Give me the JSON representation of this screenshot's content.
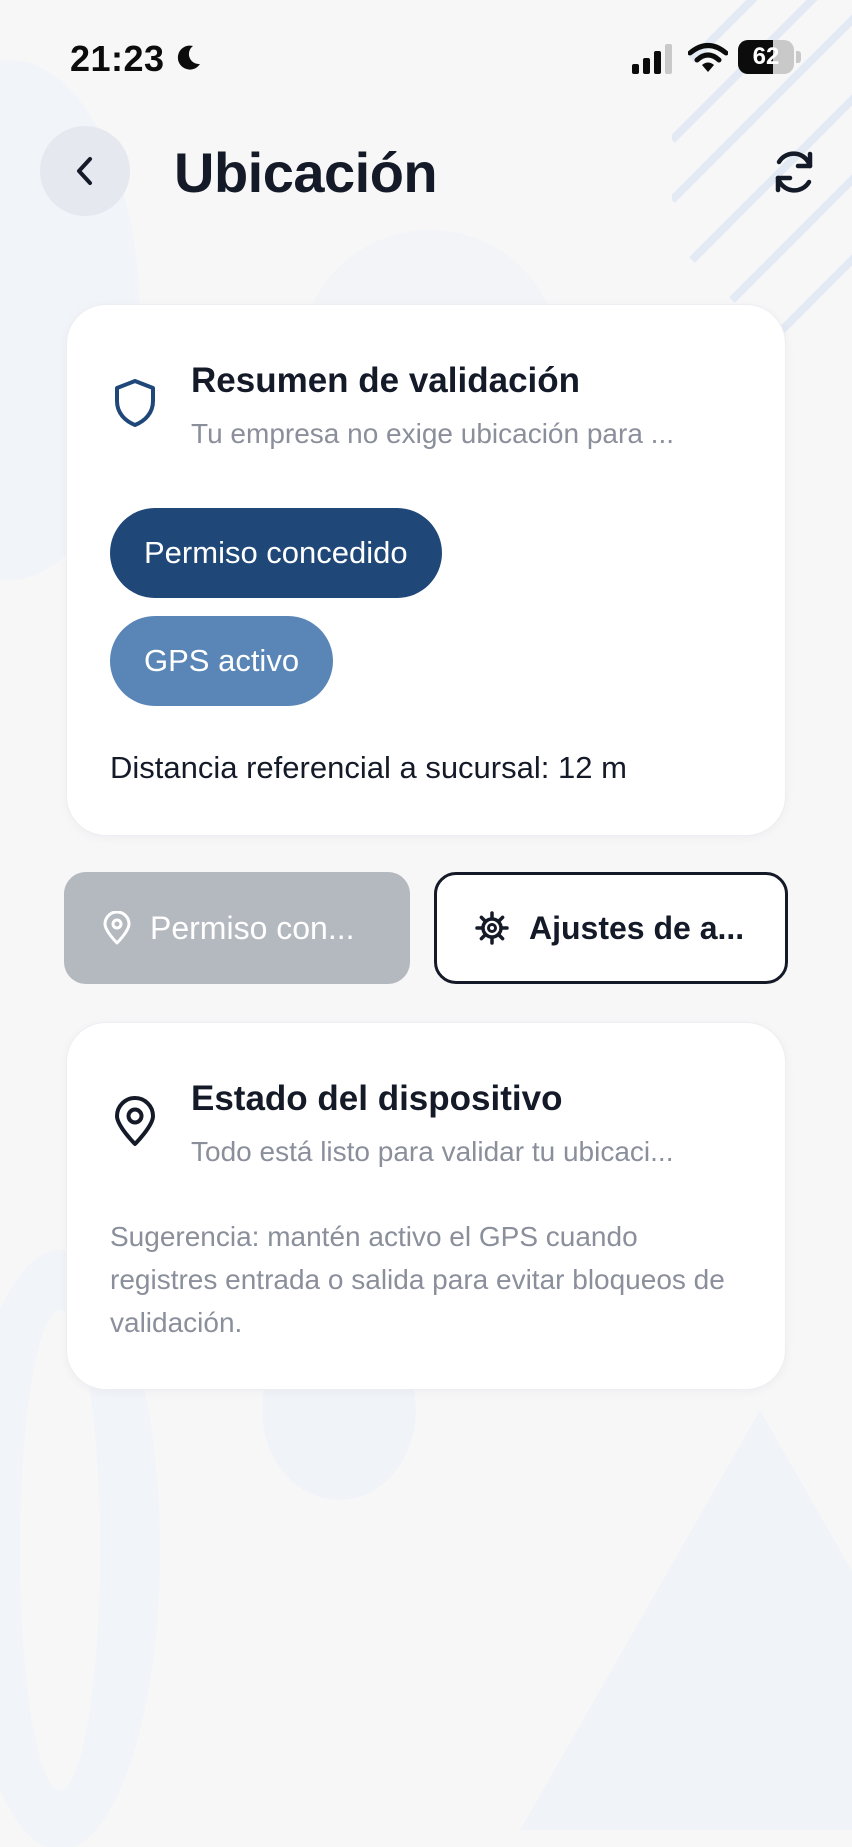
{
  "status_bar": {
    "time": "21:23",
    "battery": "62",
    "battery_level": 0.62,
    "icons": [
      "moon-icon",
      "signal-icon",
      "wifi-icon",
      "battery-icon"
    ]
  },
  "header": {
    "title": "Ubicación",
    "back_icon": "chevron-left-icon",
    "refresh_icon": "refresh-icon"
  },
  "summary_card": {
    "icon": "shield-icon",
    "title": "Resumen de validación",
    "subtitle": "Tu empresa no exige ubicación para ...",
    "chips": [
      {
        "label": "Permiso concedido",
        "color": "#1f4778"
      },
      {
        "label": "GPS activo",
        "color": "#5a86b7"
      }
    ],
    "distance": "Distancia referencial a sucursal: 12 m"
  },
  "actions": {
    "permission_button": {
      "label": "Permiso con...",
      "icon": "location-pin-icon"
    },
    "settings_button": {
      "label": "Ajustes de a...",
      "icon": "gear-icon"
    }
  },
  "device_card": {
    "icon": "location-pin-icon",
    "title": "Estado del dispositivo",
    "subtitle": "Todo está listo para validar tu ubicaci...",
    "suggestion": "Sugerencia: mantén activo el GPS cuando registres entrada o salida para evitar bloqueos de validación."
  },
  "colors": {
    "primary": "#1f4778",
    "secondary": "#5a86b7",
    "text": "#141a27",
    "muted": "#8a8f9b",
    "disabled": "#b4b8bf"
  }
}
